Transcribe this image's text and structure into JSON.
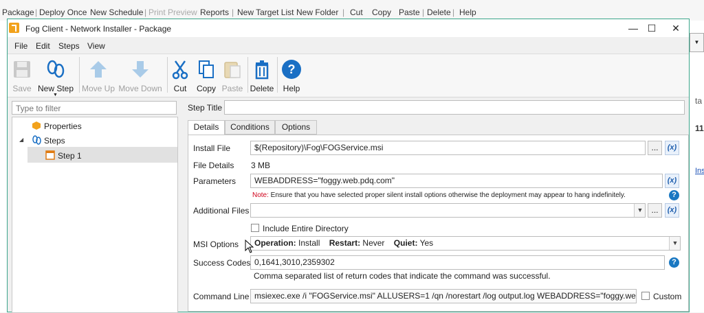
{
  "background_app": {
    "toolbar": [
      "Package",
      "Deploy Once",
      "New Schedule",
      "Print Preview",
      "Reports",
      "New Target List",
      "New Folder",
      "Cut",
      "Copy",
      "Paste",
      "Delete",
      "Help"
    ],
    "right_text": [
      "ta",
      "11",
      "Ins"
    ]
  },
  "window": {
    "title": "Fog Client - Network Installer - Package",
    "minimize": "—",
    "maximize": "☐",
    "close": "✕"
  },
  "menu": [
    "File",
    "Edit",
    "Steps",
    "View"
  ],
  "ribbon": {
    "save": "Save",
    "new_step": "New Step",
    "move_up": "Move Up",
    "move_down": "Move Down",
    "cut": "Cut",
    "copy": "Copy",
    "paste": "Paste",
    "delete": "Delete",
    "help": "Help"
  },
  "left_pane": {
    "filter_placeholder": "Type to filter",
    "tree": {
      "properties": "Properties",
      "steps": "Steps",
      "step1": "Step 1"
    }
  },
  "step_title": {
    "label": "Step Title",
    "value": ""
  },
  "tabs": [
    "Details",
    "Conditions",
    "Options"
  ],
  "details": {
    "install_file_label": "Install File",
    "install_file_value": "$(Repository)\\Fog\\FOGService.msi",
    "browse": "...",
    "var_button": "(x)",
    "file_details_label": "File Details",
    "file_details_value": "3 MB",
    "parameters_label": "Parameters",
    "parameters_value": "WEBADDRESS=\"foggy.web.pdq.com\"",
    "note_prefix": "Note:",
    "note_text": " Ensure that you have selected proper silent install options otherwise the deployment may appear to hang indefinitely.",
    "additional_files_label": "Additional Files",
    "include_dir_label": "Include Entire Directory",
    "msi_options_label": "MSI Options",
    "msi_operation_key": "Operation:",
    "msi_operation_val": "Install",
    "msi_restart_key": "Restart:",
    "msi_restart_val": "Never",
    "msi_quiet_key": "Quiet:",
    "msi_quiet_val": "Yes",
    "success_codes_label": "Success Codes",
    "success_codes_value": "0,1641,3010,2359302",
    "success_codes_hint": "Comma separated list of return codes that indicate the command was successful.",
    "command_line_label": "Command Line",
    "command_line_value": "msiexec.exe /i \"FOGService.msi\" ALLUSERS=1 /qn /norestart /log output.log WEBADDRESS=\"foggy.web.pdq.com\"",
    "custom_label": "Custom",
    "help": "?"
  },
  "colors": {
    "accent": "#1a78c2",
    "note_red": "#d0021b",
    "window_border": "#3aa58a"
  }
}
